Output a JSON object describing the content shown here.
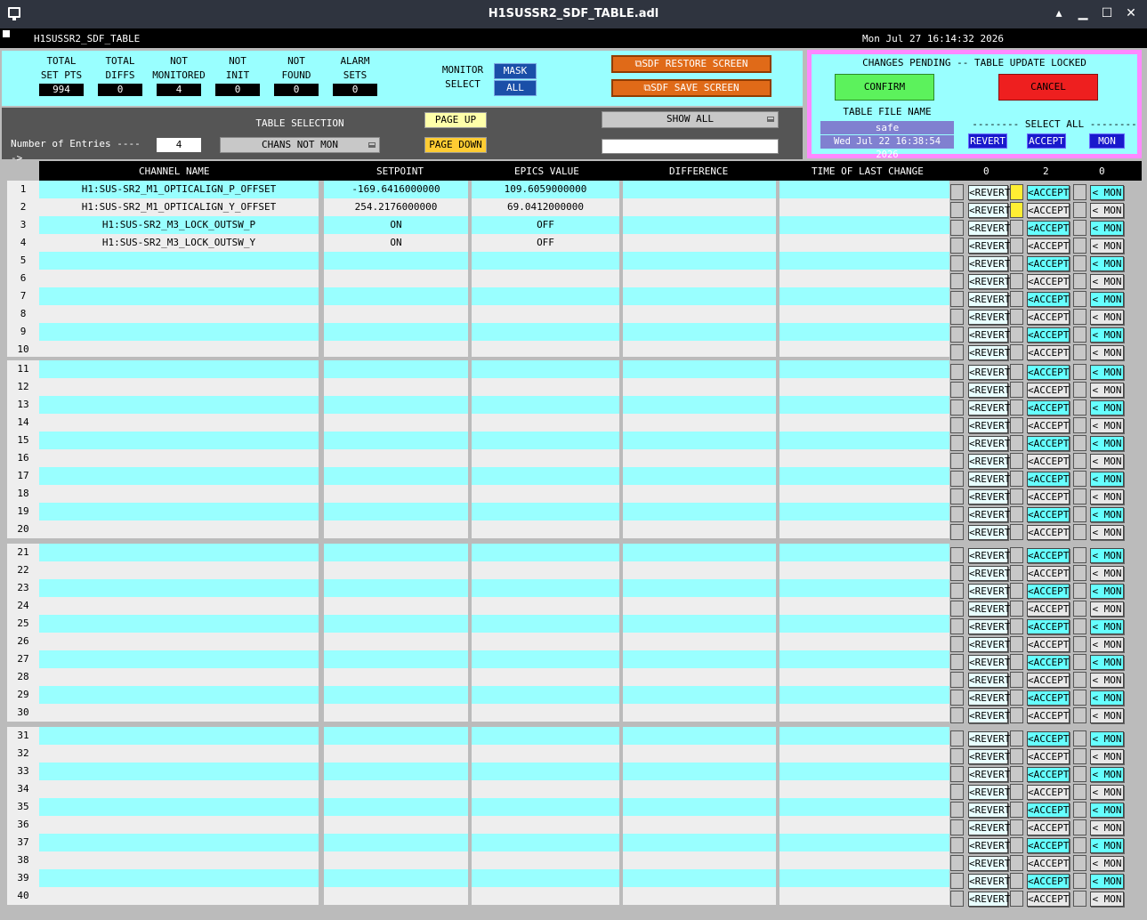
{
  "window": {
    "title": "H1SUSSR2_SDF_TABLE.adl"
  },
  "screen": {
    "name": "H1SUSSR2_SDF_TABLE",
    "datetime": "Mon Jul 27 16:14:32 2026"
  },
  "stats": [
    {
      "label1": "TOTAL",
      "label2": "SET PTS",
      "value": "994"
    },
    {
      "label1": "TOTAL",
      "label2": "DIFFS",
      "value": "0"
    },
    {
      "label1": "NOT",
      "label2": "MONITORED",
      "value": "4"
    },
    {
      "label1": "NOT",
      "label2": "INIT",
      "value": "0"
    },
    {
      "label1": "NOT",
      "label2": "FOUND",
      "value": "0"
    },
    {
      "label1": "ALARM",
      "label2": "SETS",
      "value": "0"
    }
  ],
  "monitor_select": {
    "label1": "MONITOR",
    "label2": "SELECT",
    "mask": "MASK",
    "all": "ALL"
  },
  "restore_button": "SDF RESTORE SCREEN",
  "save_button": "SDF SAVE SCREEN",
  "pending": {
    "title": "CHANGES PENDING -- TABLE UPDATE LOCKED",
    "confirm": "CONFIRM",
    "cancel": "CANCEL",
    "file_label": "TABLE FILE NAME",
    "file_name": "safe",
    "file_time": "Wed Jul 22 16:38:54 2026",
    "select_all": "-------- SELECT ALL --------",
    "revert": "REVERT",
    "accept": "ACCEPT",
    "mon": "MON"
  },
  "controls": {
    "entries_label": "Number of Entries ----->",
    "entries_value": "4",
    "table_selection_label": "TABLE SELECTION",
    "table_selection_value": "CHANS NOT MON",
    "page_up": "PAGE UP",
    "page_down": "PAGE DOWN",
    "show_all": "SHOW ALL",
    "filter_value": ""
  },
  "columns": {
    "channel": "CHANNEL NAME",
    "setpoint": "SETPOINT",
    "epics": "EPICS VALUE",
    "difference": "DIFFERENCE",
    "time": "TIME OF LAST CHANGE",
    "count_revert": "0",
    "count_accept": "2",
    "count_mon": "0"
  },
  "row_buttons": {
    "revert": "<REVERT",
    "accept": "<ACCEPT",
    "mon": "< MON"
  },
  "rows": [
    {
      "channel": "H1:SUS-SR2_M1_OPTICALIGN_P_OFFSET",
      "setpoint": "-169.6416000000",
      "epics": "109.6059000000",
      "accept_checked": true
    },
    {
      "channel": "H1:SUS-SR2_M1_OPTICALIGN_Y_OFFSET",
      "setpoint": "254.2176000000",
      "epics": "69.0412000000",
      "accept_checked": true
    },
    {
      "channel": "H1:SUS-SR2_M3_LOCK_OUTSW_P",
      "setpoint": "ON",
      "epics": "OFF",
      "accept_checked": false
    },
    {
      "channel": "H1:SUS-SR2_M3_LOCK_OUTSW_Y",
      "setpoint": "ON",
      "epics": "OFF",
      "accept_checked": false
    }
  ],
  "row_count": 40,
  "colors": {
    "cyan": "#99ffff",
    "grey_row": "#eeeeee",
    "accept_cyan": "#66ffff"
  }
}
